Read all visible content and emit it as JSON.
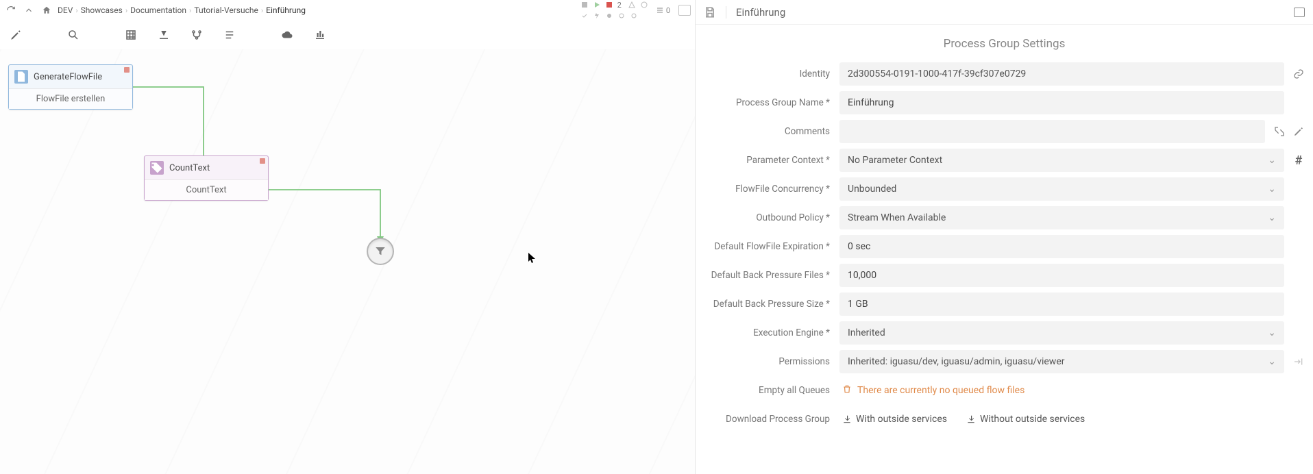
{
  "breadcrumb": {
    "root": "DEV",
    "items": [
      "Showcases",
      "Documentation",
      "Tutorial-Versuche"
    ],
    "current": "Einführung"
  },
  "topbar_status": {
    "stopped_count": "2",
    "list_count": "0"
  },
  "nodes": {
    "generate": {
      "title": "GenerateFlowFile",
      "subtitle": "FlowFile erstellen"
    },
    "count": {
      "title": "CountText",
      "subtitle": "CountText"
    }
  },
  "panel": {
    "title": "Einführung",
    "section": "Process Group Settings",
    "labels": {
      "identity": "Identity",
      "name": "Process Group Name",
      "comments": "Comments",
      "param_ctx": "Parameter Context",
      "concurrency": "FlowFile Concurrency",
      "outbound": "Outbound Policy",
      "expiration": "Default FlowFile Expiration",
      "bp_files": "Default Back Pressure Files",
      "bp_size": "Default Back Pressure Size",
      "engine": "Execution Engine",
      "permissions": "Permissions",
      "empty": "Empty all Queues",
      "download": "Download Process Group"
    },
    "values": {
      "identity": "2d300554-0191-1000-417f-39cf307e0729",
      "name": "Einführung",
      "comments": "",
      "param_ctx": "No Parameter Context",
      "concurrency": "Unbounded",
      "outbound": "Stream When Available",
      "expiration": "0 sec",
      "bp_files": "10,000",
      "bp_size": "1 GB",
      "engine": "Inherited",
      "permissions": "Inherited: iguasu/dev, iguasu/admin, iguasu/viewer"
    },
    "empty_queues_msg": "There are currently no queued flow files",
    "download": {
      "with": "With outside services",
      "without": "Without outside services"
    }
  }
}
